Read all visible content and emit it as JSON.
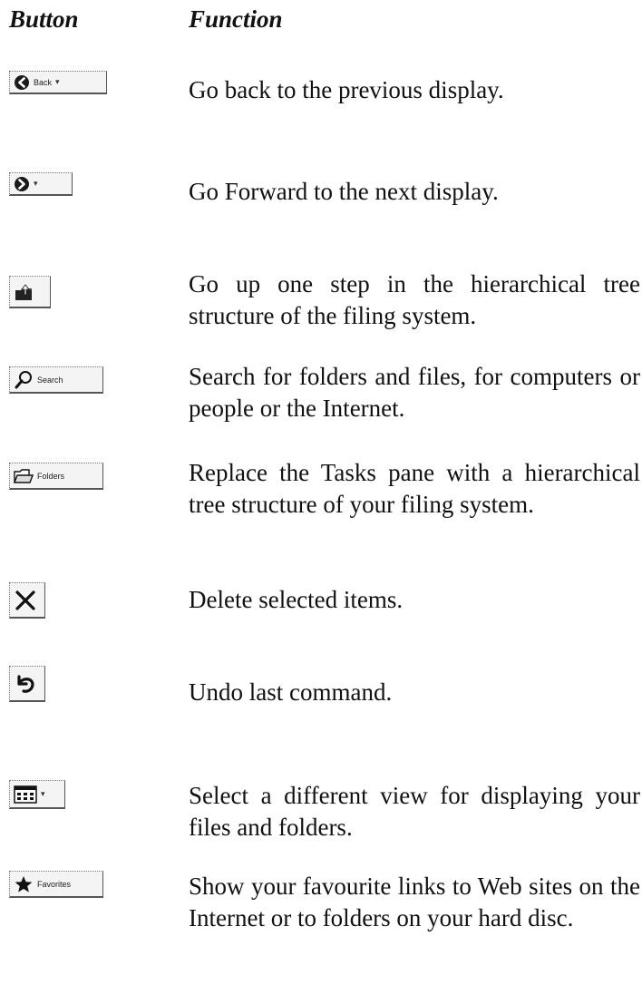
{
  "header": {
    "button_col": "Button",
    "function_col": "Function"
  },
  "rows": [
    {
      "icon": "back-arrow-icon",
      "label": "Back",
      "desc": "Go back to the previous display."
    },
    {
      "icon": "forward-arrow-icon",
      "label": "",
      "desc": "Go Forward to the next display."
    },
    {
      "icon": "up-folder-icon",
      "label": "",
      "desc": "Go up one step in the hierarchical tree structure of the filing system."
    },
    {
      "icon": "search-magnifier-icon",
      "label": "Search",
      "desc": "Search for folders and files, for computers or people or the Internet."
    },
    {
      "icon": "folders-icon",
      "label": "Folders",
      "desc": "Replace the Tasks pane with a hierarchical tree structure of your filing system."
    },
    {
      "icon": "delete-x-icon",
      "label": "",
      "desc": "Delete selected items."
    },
    {
      "icon": "undo-icon",
      "label": "",
      "desc": "Undo last command."
    },
    {
      "icon": "views-icon",
      "label": "",
      "desc": "Select a different view for displaying your files and folders."
    },
    {
      "icon": "favorites-star-icon",
      "label": "Favorites",
      "desc": "Show your favourite links to Web sites on the Internet or to folders on your hard disc."
    }
  ]
}
